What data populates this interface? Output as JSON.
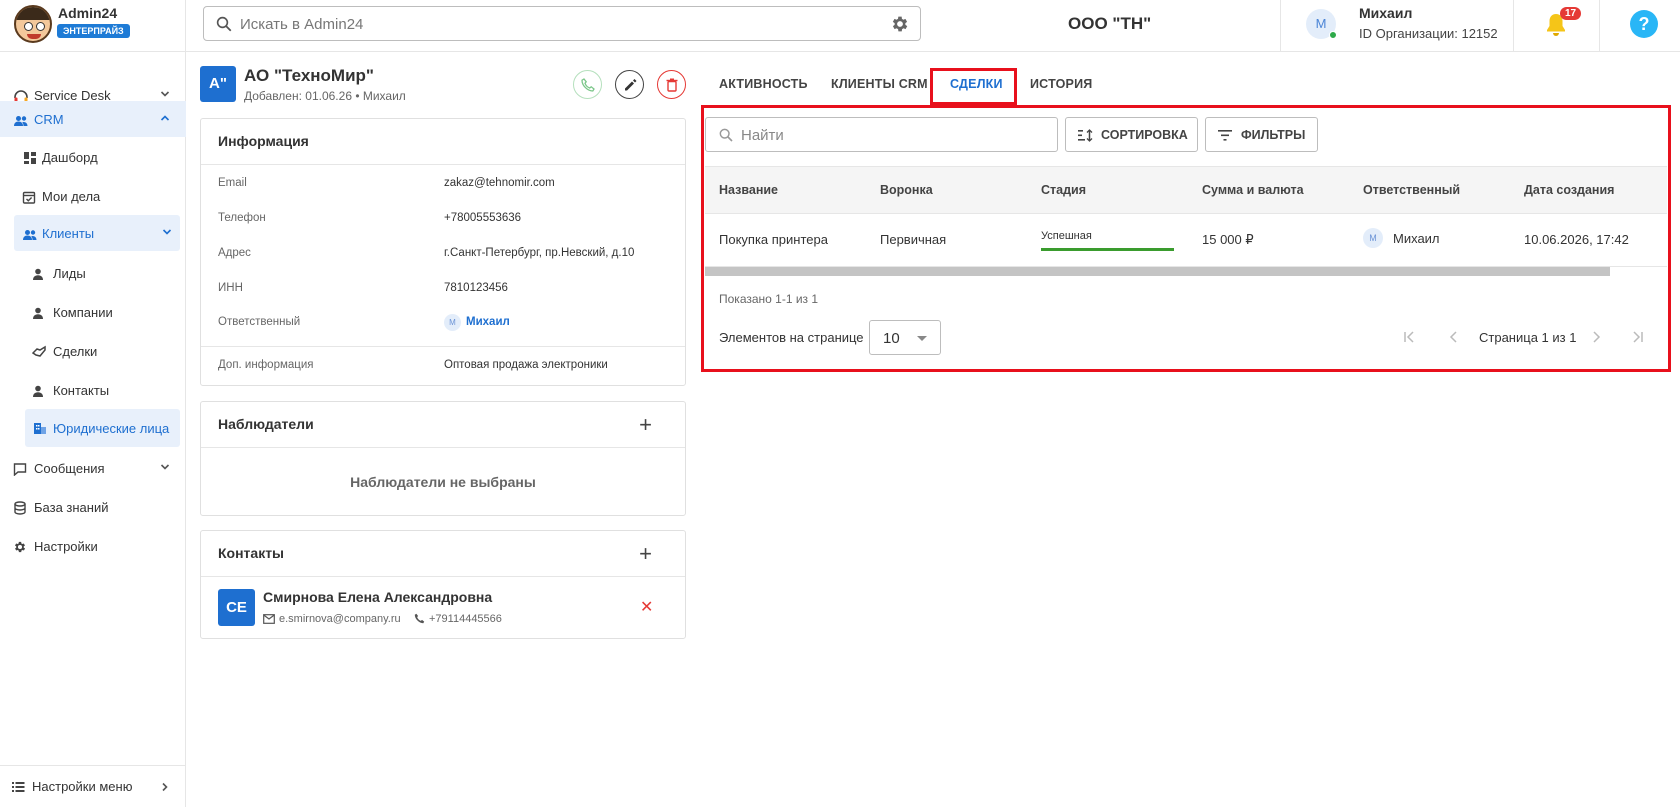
{
  "app": {
    "name": "Admin24",
    "plan": "ЭНТЕРПРАЙЗ"
  },
  "search": {
    "placeholder": "Искать в Admin24"
  },
  "org": {
    "name": "ООО \"ТН\""
  },
  "user": {
    "avatar": "М",
    "name": "Михаил",
    "org_id": "ID Организации: 12152"
  },
  "notifications": {
    "count": "17"
  },
  "help": {
    "label": "?"
  },
  "sidebar": {
    "items": [
      {
        "label": "Service Desk",
        "icon": "headset-icon"
      },
      {
        "label": "CRM",
        "icon": "people-icon"
      },
      {
        "label": "Дашборд",
        "icon": "dashboard-icon"
      },
      {
        "label": "Мои дела",
        "icon": "calendar-check-icon"
      },
      {
        "label": "Клиенты",
        "icon": "people-icon"
      },
      {
        "label": "Лиды",
        "icon": "person-icon"
      },
      {
        "label": "Компании",
        "icon": "person-icon"
      },
      {
        "label": "Сделки",
        "icon": "handshake-icon"
      },
      {
        "label": "Контакты",
        "icon": "person-icon"
      },
      {
        "label": "Юридические лица",
        "icon": "building-icon"
      },
      {
        "label": "Сообщения",
        "icon": "chat-icon"
      },
      {
        "label": "База знаний",
        "icon": "database-icon"
      },
      {
        "label": "Настройки",
        "icon": "gear-icon"
      }
    ],
    "menu_settings": "Настройки меню"
  },
  "company": {
    "avatar": "А\"",
    "name": "АО \"ТехноМир\"",
    "added": "Добавлен: 01.06.26 • Михаил"
  },
  "info": {
    "title": "Информация",
    "rows": [
      {
        "label": "Email",
        "value": "zakaz@tehnomir.com"
      },
      {
        "label": "Телефон",
        "value": "+78005553636"
      },
      {
        "label": "Адрес",
        "value": "г.Санкт-Петербург, пр.Невский, д.10"
      },
      {
        "label": "ИНН",
        "value": "7810123456"
      },
      {
        "label": "Ответственный",
        "value": "Михаил",
        "avatar": "М"
      },
      {
        "label": "Доп. информация",
        "value": "Оптовая продажа электроники"
      }
    ]
  },
  "observers": {
    "title": "Наблюдатели",
    "empty": "Наблюдатели не выбраны"
  },
  "contacts": {
    "title": "Контакты",
    "items": [
      {
        "avatar": "СЕ",
        "name": "Смирнова Елена Александровна",
        "email": "e.smirnova@company.ru",
        "phone": "+79114445566"
      }
    ]
  },
  "tabs": [
    {
      "label": "АКТИВНОСТЬ"
    },
    {
      "label": "КЛИЕНТЫ CRM"
    },
    {
      "label": "СДЕЛКИ"
    },
    {
      "label": "ИСТОРИЯ"
    }
  ],
  "deals": {
    "search_placeholder": "Найти",
    "sort_label": "СОРТИРОВКА",
    "filter_label": "ФИЛЬТРЫ",
    "columns": [
      "Название",
      "Воронка",
      "Стадия",
      "Сумма и валюта",
      "Ответственный",
      "Дата создания"
    ],
    "rows": [
      {
        "name": "Покупка принтера",
        "funnel": "Первичная",
        "stage": "Успешная",
        "amount": "15 000 ₽",
        "owner_avatar": "М",
        "owner": "Михаил",
        "created": "10.06.2026, 17:42"
      }
    ],
    "shown": "Показано 1-1 из 1",
    "per_page_label": "Элементов на странице",
    "per_page": "10",
    "page_text": "Страница 1 из 1"
  },
  "colors": {
    "accent": "#1e6fd0",
    "highlight": "#e8101c",
    "success": "#3a9c2e"
  }
}
